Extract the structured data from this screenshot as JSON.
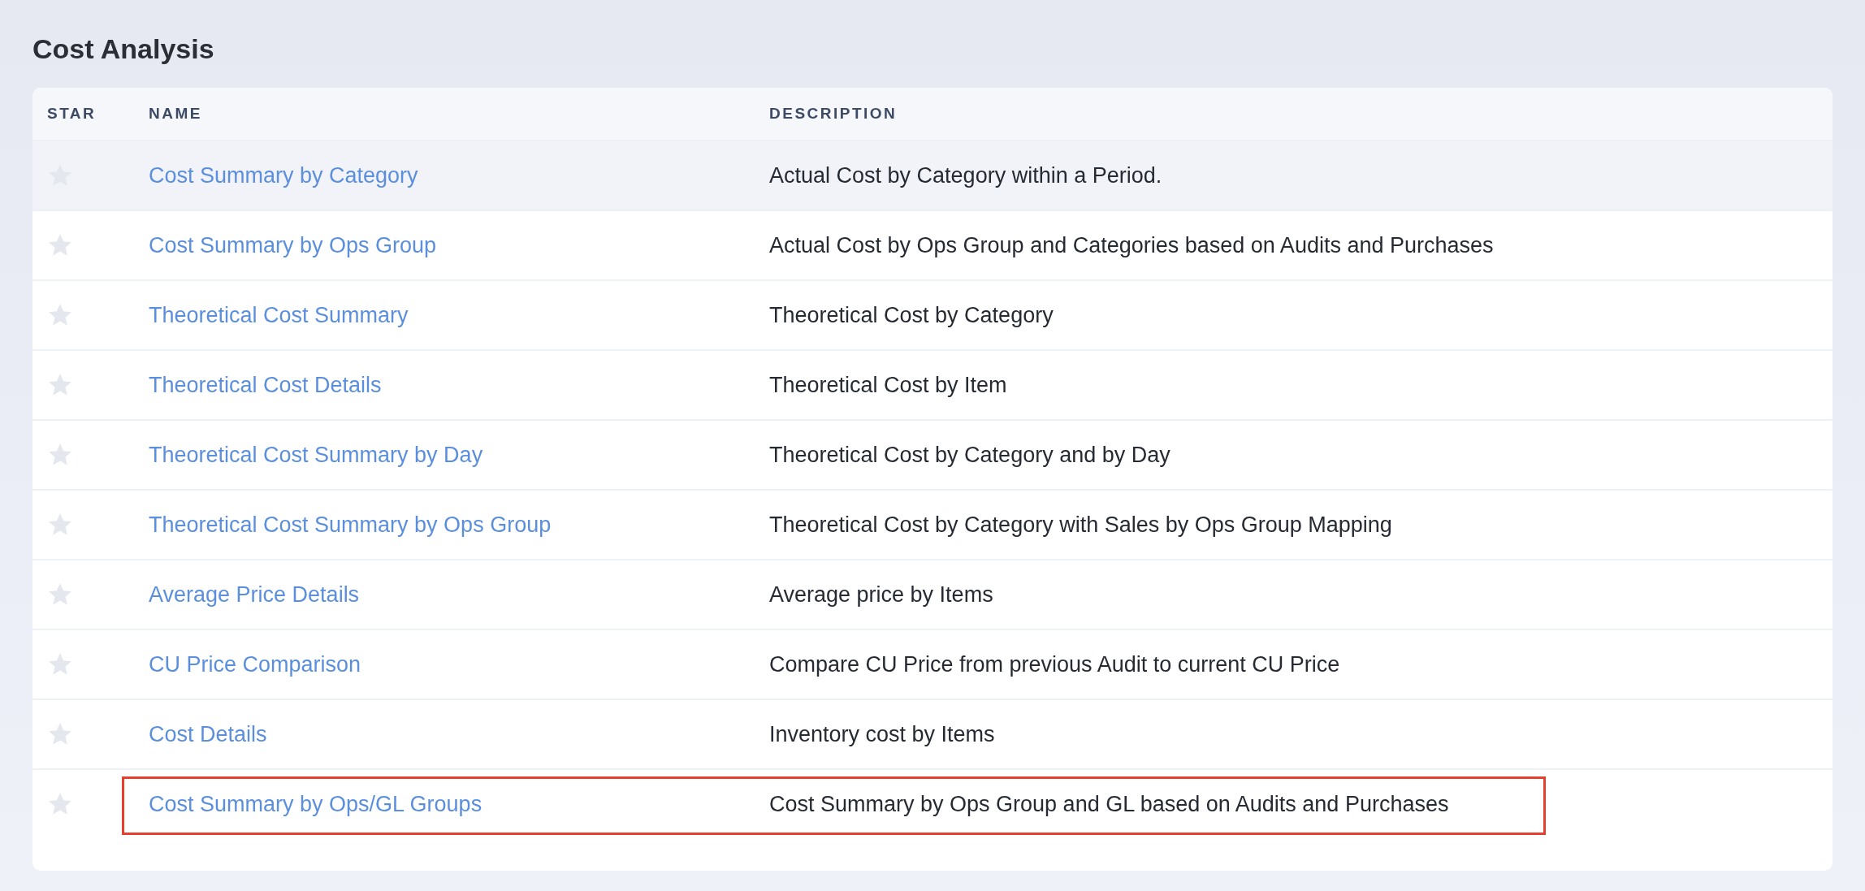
{
  "title": "Cost Analysis",
  "table": {
    "columns": [
      "STAR",
      "NAME",
      "DESCRIPTION"
    ],
    "rows": [
      {
        "starred": false,
        "highlighted": true,
        "annotated": false,
        "name": "Cost Summary by Category",
        "description": "Actual Cost by Category within a Period."
      },
      {
        "starred": false,
        "highlighted": false,
        "annotated": false,
        "name": "Cost Summary by Ops Group",
        "description": "Actual Cost by Ops Group and Categories based on Audits and Purchases"
      },
      {
        "starred": false,
        "highlighted": false,
        "annotated": false,
        "name": "Theoretical Cost Summary",
        "description": "Theoretical Cost by Category"
      },
      {
        "starred": false,
        "highlighted": false,
        "annotated": false,
        "name": "Theoretical Cost Details",
        "description": "Theoretical Cost by Item"
      },
      {
        "starred": false,
        "highlighted": false,
        "annotated": false,
        "name": "Theoretical Cost Summary by Day",
        "description": "Theoretical Cost by Category and by Day"
      },
      {
        "starred": false,
        "highlighted": false,
        "annotated": false,
        "name": "Theoretical Cost Summary by Ops Group",
        "description": "Theoretical Cost by Category with Sales by Ops Group Mapping"
      },
      {
        "starred": false,
        "highlighted": false,
        "annotated": false,
        "name": "Average Price Details",
        "description": "Average price by Items"
      },
      {
        "starred": false,
        "highlighted": false,
        "annotated": false,
        "name": "CU Price Comparison",
        "description": "Compare CU Price from previous Audit to current CU Price"
      },
      {
        "starred": false,
        "highlighted": false,
        "annotated": false,
        "name": "Cost Details",
        "description": "Inventory cost by Items"
      },
      {
        "starred": false,
        "highlighted": false,
        "annotated": true,
        "name": "Cost Summary by Ops/GL Groups",
        "description": "Cost Summary by Ops Group and GL based on Audits and Purchases"
      }
    ]
  }
}
